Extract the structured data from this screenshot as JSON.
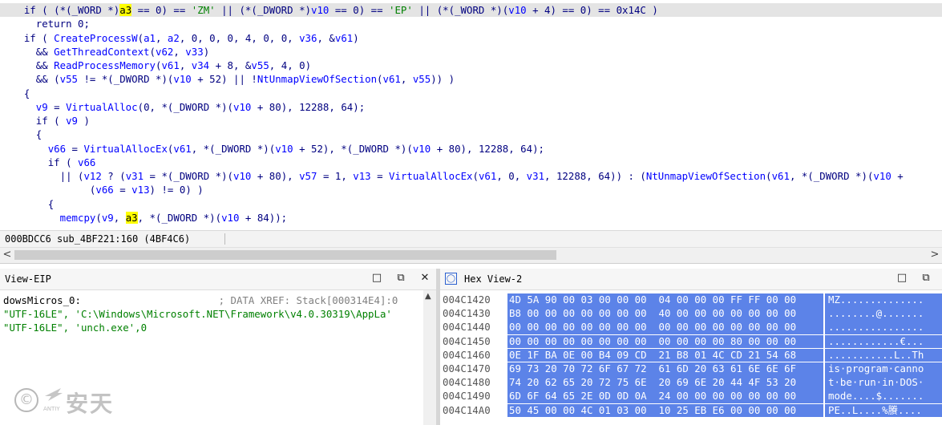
{
  "code_lines": [
    {
      "indent": "    ",
      "text": "if ( (*(_WORD *)a3 == 0) == 'ZM' || (*(_DWORD *)v10 == 0) == 'EP' || (*(_WORD *)(v10 + 4) == 0) == 0x14C )",
      "highlight": true
    },
    {
      "indent": "      ",
      "text": "return 0;"
    },
    {
      "indent": "    ",
      "text": "if ( CreateProcessW(a1, a2, 0, 0, 0, 4, 0, 0, v36, &v61)"
    },
    {
      "indent": "      ",
      "text": "&& GetThreadContext(v62, v33)"
    },
    {
      "indent": "      ",
      "text": "&& ReadProcessMemory(v61, v34 + 8, &v55, 4, 0)"
    },
    {
      "indent": "      ",
      "text": "&& (v55 != *(_DWORD *)(v10 + 52) || !NtUnmapViewOfSection(v61, v55)) )"
    },
    {
      "indent": "    ",
      "text": "{"
    },
    {
      "indent": "      ",
      "text": "v9 = VirtualAlloc(0, *(_DWORD *)(v10 + 80), 12288, 64);"
    },
    {
      "indent": "      ",
      "text": "if ( v9 )"
    },
    {
      "indent": "      ",
      "text": "{"
    },
    {
      "indent": "        ",
      "text": "v66 = VirtualAllocEx(v61, *(_DWORD *)(v10 + 52), *(_DWORD *)(v10 + 80), 12288, 64);"
    },
    {
      "indent": "        ",
      "text": "if ( v66"
    },
    {
      "indent": "          ",
      "text": "|| (v12 ? (v31 = *(_DWORD *)(v10 + 80), v57 = 1, v13 = VirtualAllocEx(v61, 0, v31, 12288, 64)) : (NtUnmapViewOfSection(v61, *(_DWORD *)(v10 +"
    },
    {
      "indent": "               ",
      "text": "(v66 = v13) != 0) )"
    },
    {
      "indent": "        ",
      "text": "{"
    },
    {
      "indent": "          ",
      "text": "memcpy(v9, a3, *(_DWORD *)(v10 + 84));"
    }
  ],
  "status": {
    "text": "000BDCC6 sub_4BF221:160 (4BF4C6)"
  },
  "eip": {
    "title": "View-EIP",
    "lines": [
      "dowsMicros_0:                       ; DATA XREF: Stack[000314E4]:0",
      "\"UTF-16LE\", 'C:\\Windows\\Microsoft.NET\\Framework\\v4.0.30319\\AppLa'",
      "\"UTF-16LE\", 'unch.exe',0"
    ]
  },
  "hex": {
    "title": "Hex View-2",
    "rows": [
      {
        "addr": "004C1420",
        "bytes": "4D 5A 90 00 03 00 00 00  04 00 00 00 FF FF 00 00",
        "ascii": "MZ.............."
      },
      {
        "addr": "004C1430",
        "bytes": "B8 00 00 00 00 00 00 00  40 00 00 00 00 00 00 00",
        "ascii": "........@......."
      },
      {
        "addr": "004C1440",
        "bytes": "00 00 00 00 00 00 00 00  00 00 00 00 00 00 00 00",
        "ascii": "................"
      },
      {
        "addr": "004C1450",
        "bytes": "00 00 00 00 00 00 00 00  00 00 00 00 80 00 00 00",
        "ascii": "............€..."
      },
      {
        "addr": "004C1460",
        "bytes": "0E 1F BA 0E 00 B4 09 CD  21 B8 01 4C CD 21 54 68",
        "ascii": "...........L..Th"
      },
      {
        "addr": "004C1470",
        "bytes": "69 73 20 70 72 6F 67 72  61 6D 20 63 61 6E 6E 6F",
        "ascii": "is·program·canno"
      },
      {
        "addr": "004C1480",
        "bytes": "74 20 62 65 20 72 75 6E  20 69 6E 20 44 4F 53 20",
        "ascii": "t·be·run·in·DOS·"
      },
      {
        "addr": "004C1490",
        "bytes": "6D 6F 64 65 2E 0D 0D 0A  24 00 00 00 00 00 00 00",
        "ascii": "mode....$......."
      },
      {
        "addr": "004C14A0",
        "bytes": "50 45 00 00 4C 01 03 00  10 25 EB E6 00 00 00 00",
        "ascii": "PE..L....%賸...."
      }
    ]
  },
  "watermark": {
    "brand": "安天",
    "small": "ANTIY"
  },
  "colors": {
    "keyword": "#000080",
    "function": "#0000ff",
    "string_literal": "#008000",
    "highlight": "#ffff00",
    "hex_selection": "#5c83e8"
  }
}
